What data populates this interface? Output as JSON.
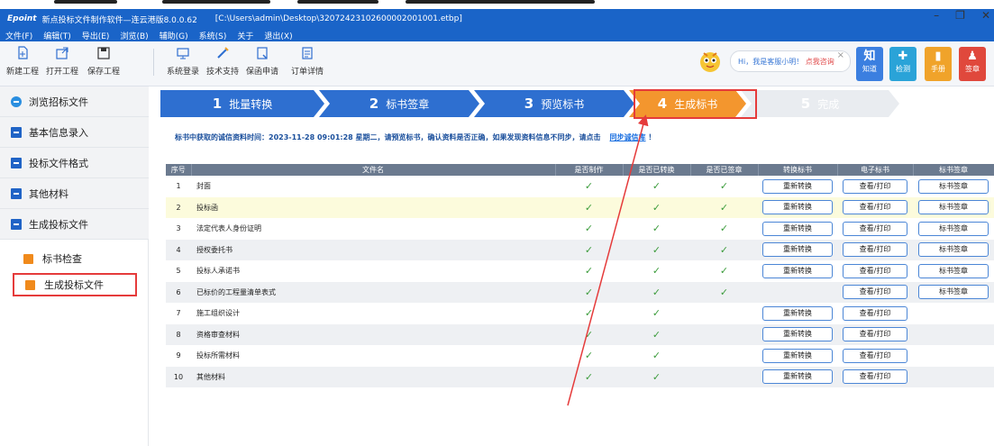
{
  "window": {
    "brand": "Epoint",
    "title": "新点投标文件制作软件—连云港版8.0.0.62",
    "path": "[C:\\Users\\admin\\Desktop\\32072423102600002001001.etbp]",
    "controls": [
      "–",
      "❐",
      "✕"
    ]
  },
  "menu": [
    "文件(F)",
    "编辑(T)",
    "导出(E)",
    "浏览(B)",
    "辅助(G)",
    "系统(S)",
    "关于",
    "退出(X)"
  ],
  "toolbar": {
    "buttons": [
      {
        "label": "新建工程",
        "icon": "new-project-icon"
      },
      {
        "label": "打开工程",
        "icon": "open-project-icon"
      },
      {
        "label": "保存工程",
        "icon": "save-icon"
      },
      {
        "label": "系统登录",
        "icon": "login-icon"
      },
      {
        "label": "技术支持",
        "icon": "support-icon"
      },
      {
        "label": "保函申请",
        "icon": "guarantee-icon"
      },
      {
        "label": "订单详情",
        "icon": "order-icon"
      }
    ],
    "assistant": {
      "text": "Hi，我是客服小明！",
      "link": "点我咨询"
    },
    "tiles": [
      {
        "label": "知道",
        "glyph": "知",
        "color": "#3b7fe0"
      },
      {
        "label": "检测",
        "glyph": "✚",
        "color": "#2aa3d8"
      },
      {
        "label": "手册",
        "glyph": "▮",
        "color": "#f0a32a"
      },
      {
        "label": "签章",
        "glyph": "♟",
        "color": "#e0483c"
      }
    ]
  },
  "sidebar": {
    "items": [
      "浏览招标文件",
      "基本信息录入",
      "投标文件格式",
      "其他材料",
      "生成投标文件"
    ],
    "subitems": [
      "标书检查",
      "生成投标文件"
    ],
    "active": "生成投标文件"
  },
  "steps": [
    {
      "num": "1",
      "label": "批量转换"
    },
    {
      "num": "2",
      "label": "标书签章"
    },
    {
      "num": "3",
      "label": "预览标书"
    },
    {
      "num": "4",
      "label": "生成标书"
    },
    {
      "num": "5",
      "label": "完成"
    }
  ],
  "notice": {
    "text": "标书中获取的诚信资料时间：2023-11-28 09:01:28 星期二，请预览标书，确认资料是否正确，如果发现资料信息不同步，请点击",
    "link": "同步诚信库",
    "suffix": "！"
  },
  "table": {
    "headers": [
      "序号",
      "文件名",
      "是否制作",
      "是否已转换",
      "是否已签章",
      "转换标书",
      "电子标书",
      "标书签章"
    ],
    "rows": [
      {
        "no": "1",
        "name": "封面",
        "made": true,
        "converted": true,
        "signed": true,
        "convert": "重新转换",
        "view": "查看/打印",
        "sign": "标书签章"
      },
      {
        "no": "2",
        "name": "投标函",
        "made": true,
        "converted": true,
        "signed": true,
        "convert": "重新转换",
        "view": "查看/打印",
        "sign": "标书签章"
      },
      {
        "no": "3",
        "name": "法定代表人身份证明",
        "made": true,
        "converted": true,
        "signed": true,
        "convert": "重新转换",
        "view": "查看/打印",
        "sign": "标书签章"
      },
      {
        "no": "4",
        "name": "授权委托书",
        "made": true,
        "converted": true,
        "signed": true,
        "convert": "重新转换",
        "view": "查看/打印",
        "sign": "标书签章"
      },
      {
        "no": "5",
        "name": "投标人承诺书",
        "made": true,
        "converted": true,
        "signed": true,
        "convert": "重新转换",
        "view": "查看/打印",
        "sign": "标书签章"
      },
      {
        "no": "6",
        "name": "已标价的工程量清单表式",
        "made": true,
        "converted": true,
        "signed": true,
        "convert": "",
        "view": "查看/打印",
        "sign": "标书签章"
      },
      {
        "no": "7",
        "name": "施工组织设计",
        "made": true,
        "converted": true,
        "signed": false,
        "convert": "重新转换",
        "view": "查看/打印",
        "sign": ""
      },
      {
        "no": "8",
        "name": "资格审查材料",
        "made": true,
        "converted": true,
        "signed": false,
        "convert": "重新转换",
        "view": "查看/打印",
        "sign": ""
      },
      {
        "no": "9",
        "name": "投标所需材料",
        "made": true,
        "converted": true,
        "signed": false,
        "convert": "重新转换",
        "view": "查看/打印",
        "sign": ""
      },
      {
        "no": "10",
        "name": "其他材料",
        "made": true,
        "converted": true,
        "signed": false,
        "convert": "重新转换",
        "view": "查看/打印",
        "sign": ""
      }
    ]
  },
  "colors": {
    "accent": "#1a64c8",
    "step_active": "#f3962e",
    "highlight": "#e53b3b",
    "check": "#3c9c3c"
  }
}
